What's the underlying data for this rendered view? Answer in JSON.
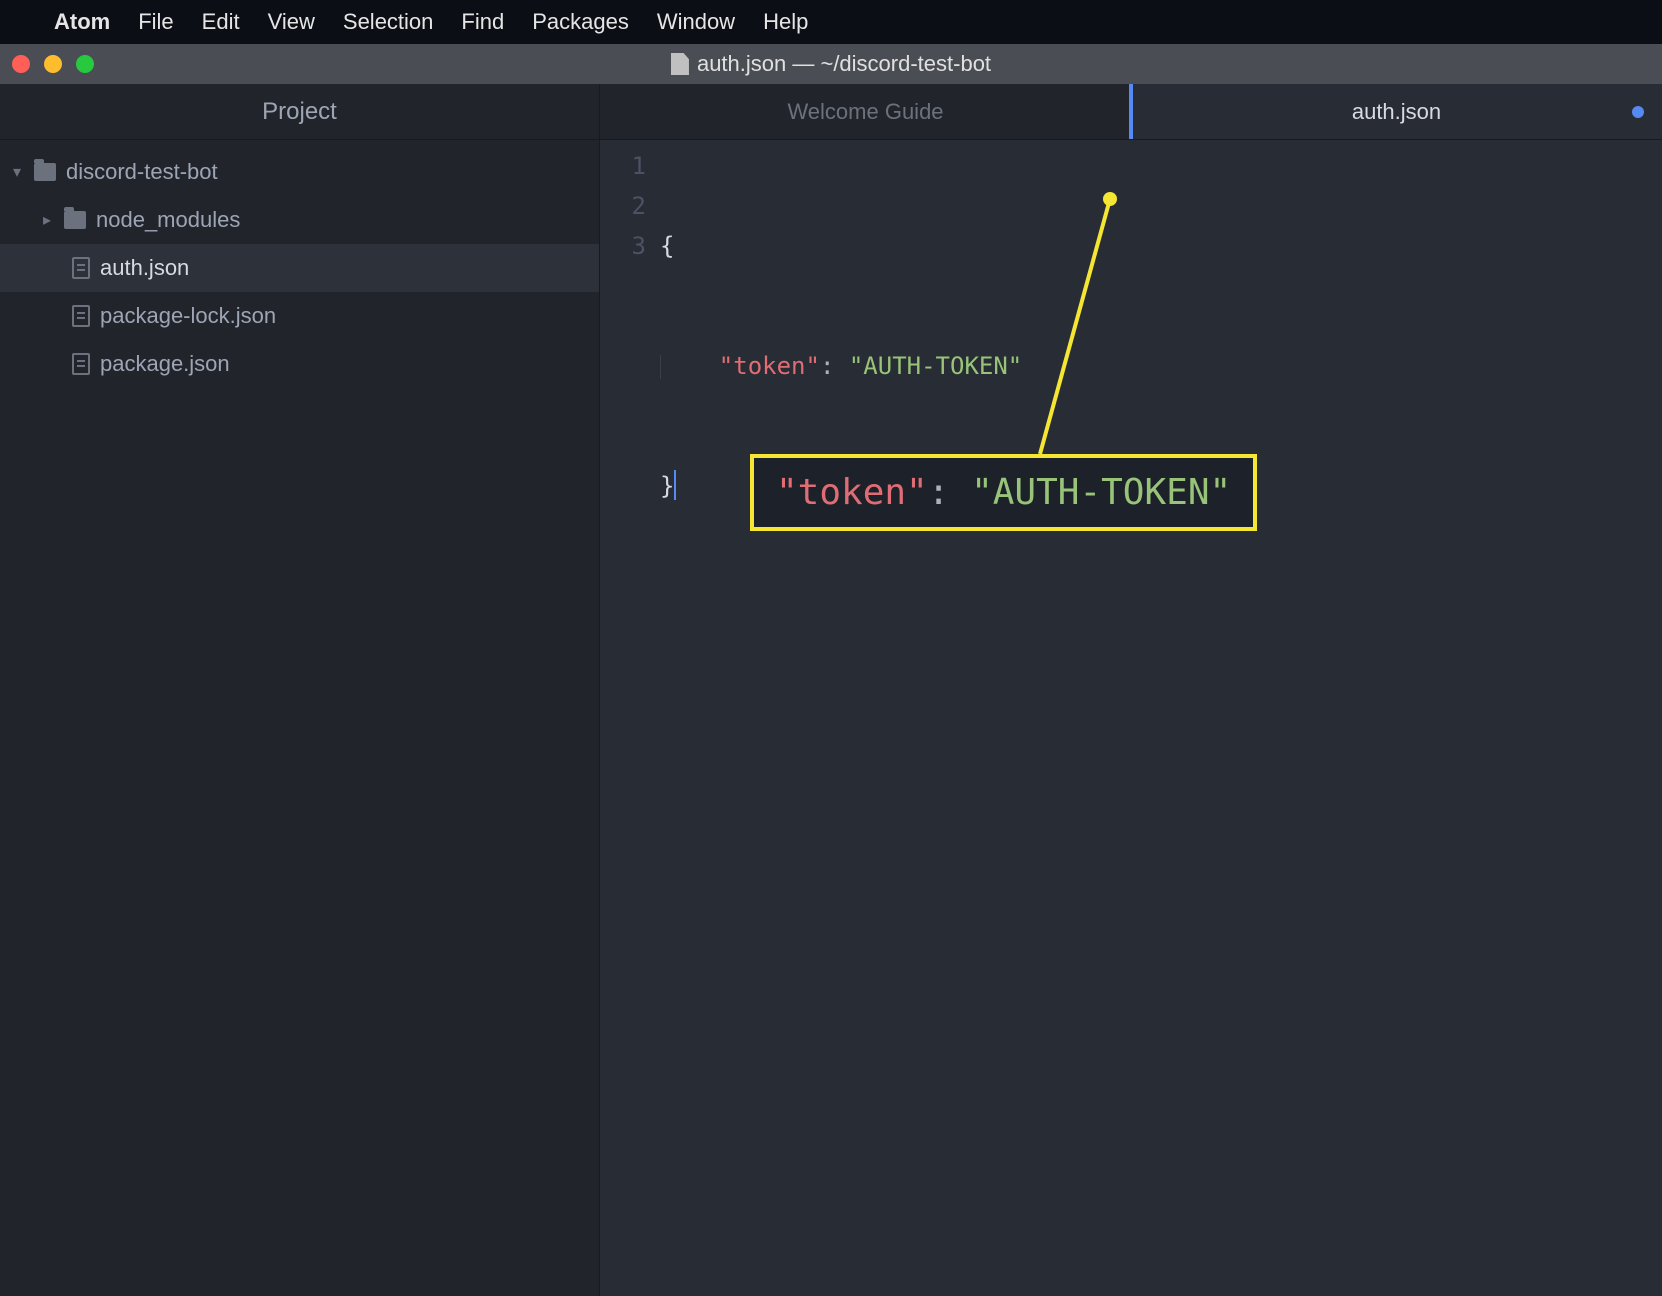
{
  "menubar": {
    "app_name": "Atom",
    "items": [
      "File",
      "Edit",
      "View",
      "Selection",
      "Find",
      "Packages",
      "Window",
      "Help"
    ]
  },
  "titlebar": {
    "title": "auth.json — ~/discord-test-bot"
  },
  "sidebar": {
    "header": "Project",
    "root": {
      "name": "discord-test-bot",
      "expanded": true
    },
    "children": [
      {
        "name": "node_modules",
        "type": "folder",
        "expanded": false
      },
      {
        "name": "auth.json",
        "type": "file",
        "selected": true
      },
      {
        "name": "package-lock.json",
        "type": "file",
        "selected": false
      },
      {
        "name": "package.json",
        "type": "file",
        "selected": false
      }
    ]
  },
  "tabs": [
    {
      "label": "Welcome Guide",
      "active": false,
      "dirty": false
    },
    {
      "label": "auth.json",
      "active": true,
      "dirty": true
    }
  ],
  "editor": {
    "line_numbers": [
      "1",
      "2",
      "3"
    ],
    "content": {
      "line1_brace": "{",
      "line2_indent": "    ",
      "line2_key": "\"token\"",
      "line2_colon": ": ",
      "line2_value": "\"AUTH-TOKEN\"",
      "line3_brace": "}"
    }
  },
  "callout": {
    "key": "\"token\"",
    "colon": ": ",
    "value": "\"AUTH-TOKEN\""
  },
  "colors": {
    "accent": "#568af2",
    "key": "#e06c75",
    "string": "#98c379",
    "highlight": "#f5e633"
  }
}
